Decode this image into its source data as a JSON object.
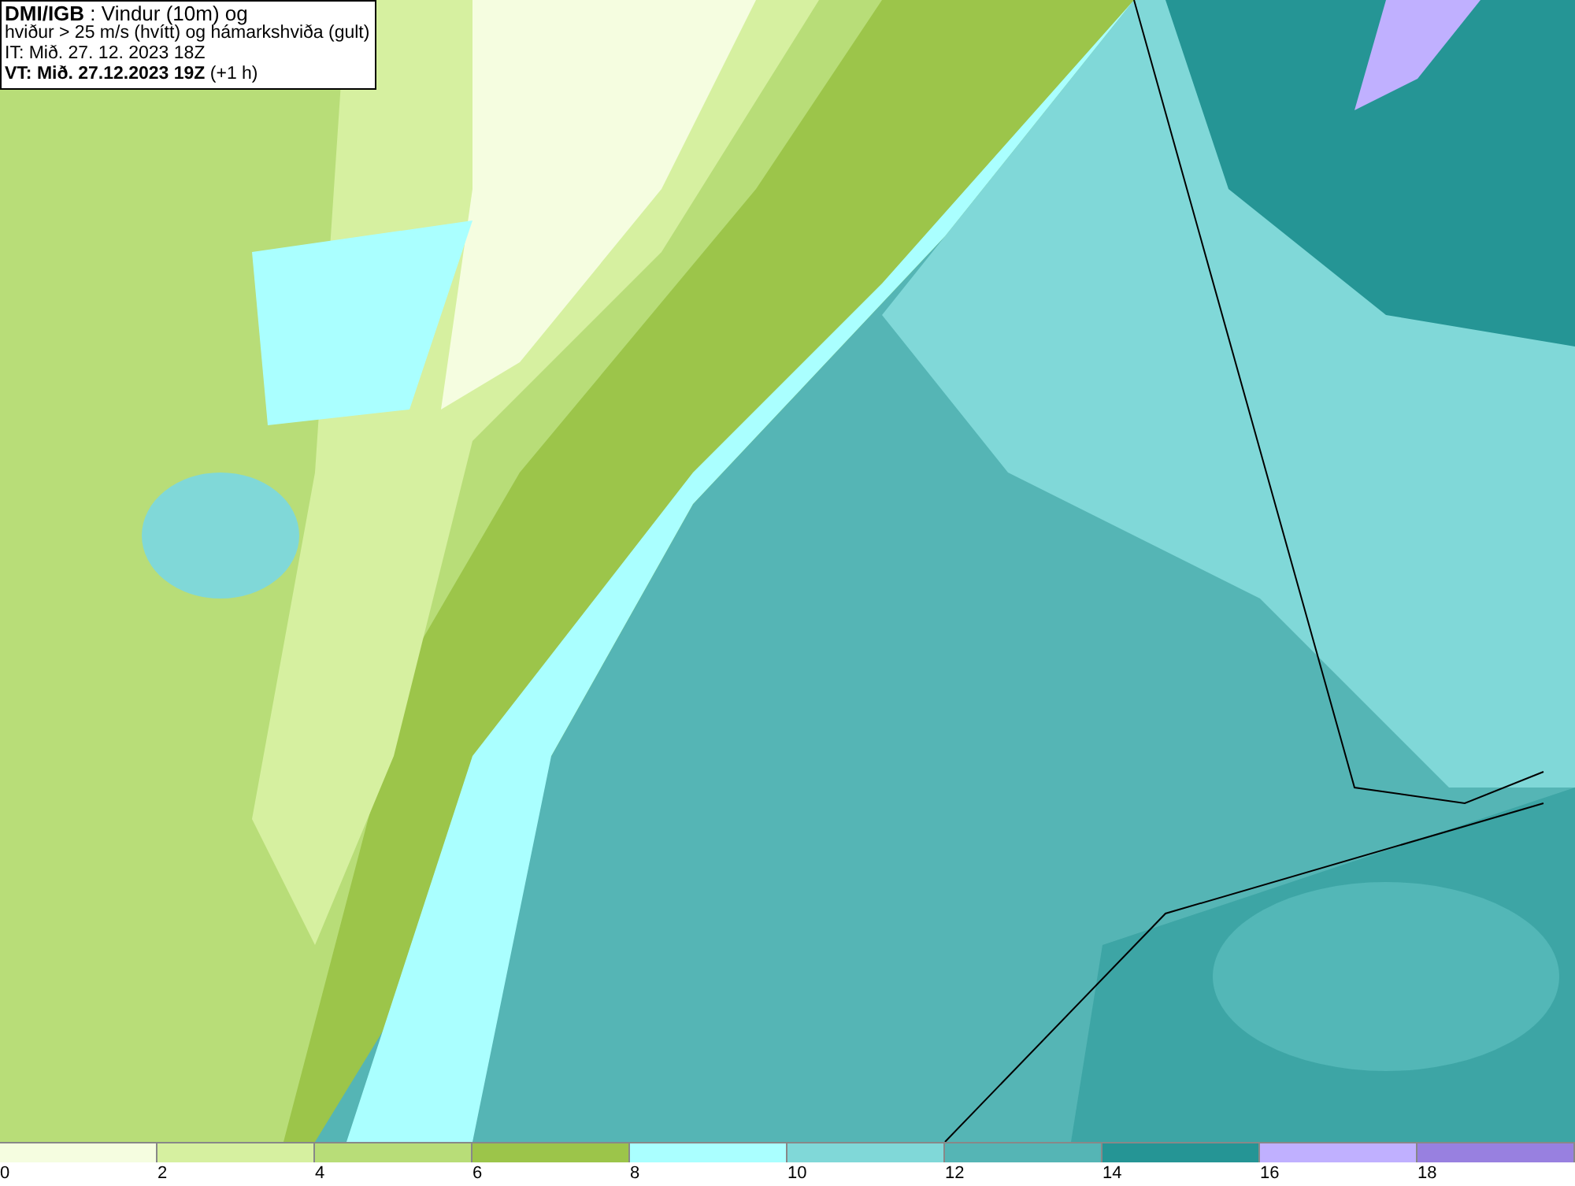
{
  "info_box": {
    "lines": [
      "**DMI/IGB** : Vindur (10m) og",
      "hviður > 25 m/s (hvítt) og hámarkshviða (gult)",
      "IT: Mið. 27. 12. 2023 18Z",
      "**VT: Mið. 27.12.2023 19Z** (+1 h)"
    ]
  },
  "legend": {
    "bins": [
      {
        "label": "0",
        "color": "#f5fde0"
      },
      {
        "label": "2",
        "color": "#d6f0a0"
      },
      {
        "label": "4",
        "color": "#b8dd78"
      },
      {
        "label": "6",
        "color": "#9cc54a"
      },
      {
        "label": "8",
        "color": "#aaffff"
      },
      {
        "label": "10",
        "color": "#80d8d8"
      },
      {
        "label": "12",
        "color": "#55b5b5"
      },
      {
        "label": "14",
        "color": "#259595"
      },
      {
        "label": "16",
        "color": "#c0b0ff"
      },
      {
        "label": "18",
        "color": "#9880e0"
      }
    ]
  }
}
